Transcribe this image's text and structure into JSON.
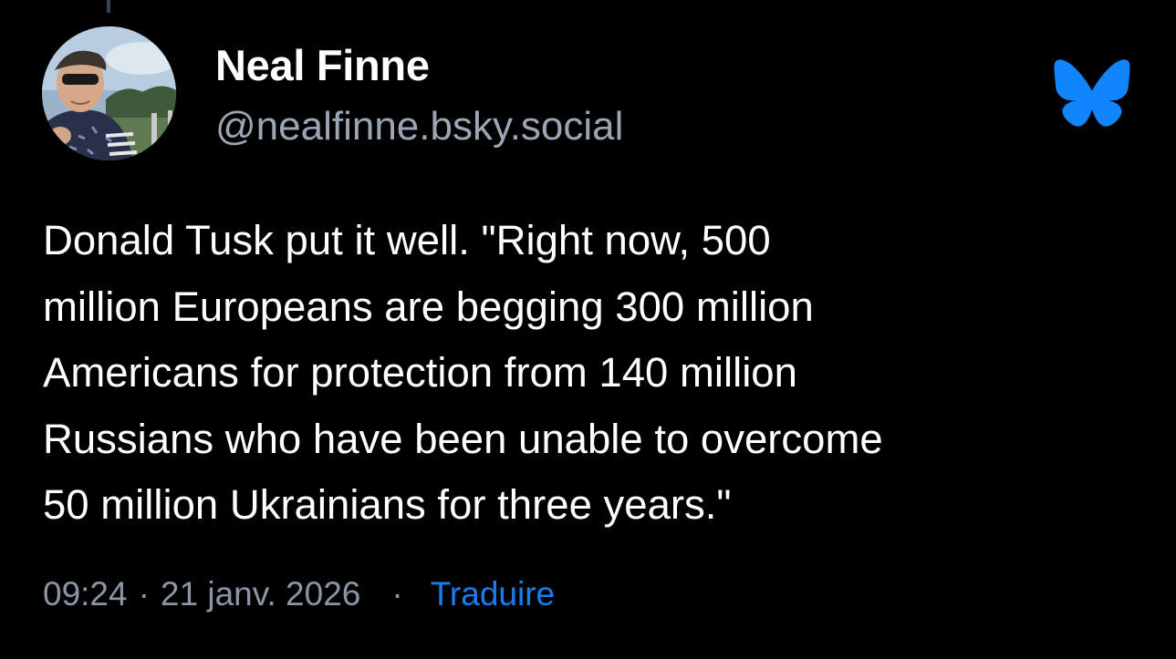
{
  "author": {
    "display_name": "Neal Finne",
    "handle": "@nealfinne.bsky.social",
    "avatar_icon": "profile-photo"
  },
  "brand": {
    "icon": "bluesky-butterfly-icon",
    "color": "#1185fe"
  },
  "post": {
    "text_lines": [
      "Donald Tusk put it well. \"Right now, 500",
      "million Europeans are begging 300 million",
      "Americans for protection from 140 million",
      "Russians who have been unable to overcome",
      "50 million Ukrainians for three years.\""
    ]
  },
  "meta": {
    "time": "09:24",
    "separator": "·",
    "date": "21 janv. 2026",
    "translate_label": "Traduire"
  },
  "colors": {
    "background": "#000000",
    "text": "#ffffff",
    "secondary_text": "#9aa6b4",
    "link": "#1b7cf0"
  }
}
